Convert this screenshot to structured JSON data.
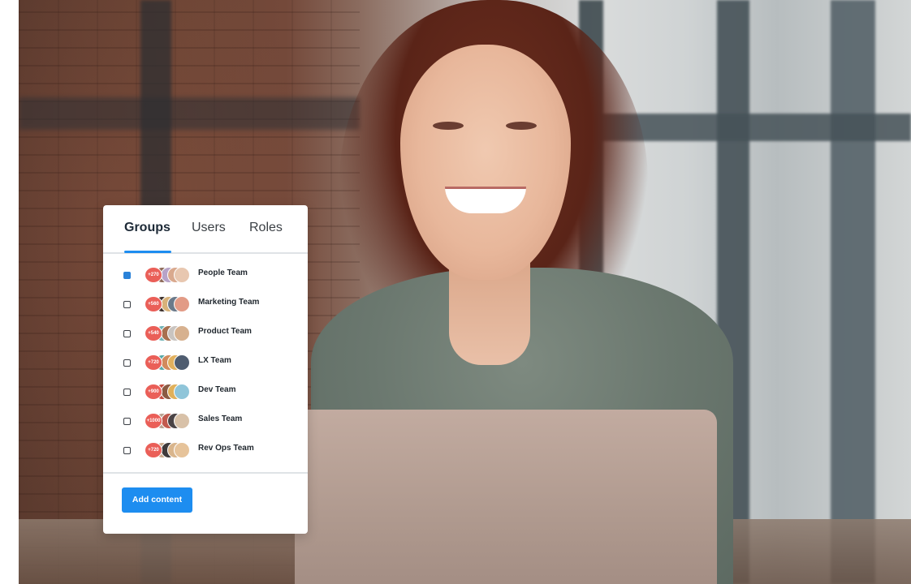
{
  "panel": {
    "tabs": [
      {
        "label": "Groups",
        "active": true
      },
      {
        "label": "Users",
        "active": false
      },
      {
        "label": "Roles",
        "active": false
      }
    ],
    "groups": [
      {
        "name": "People Team",
        "count": "+270",
        "checked": true
      },
      {
        "name": "Marketing Team",
        "count": "+560",
        "checked": false
      },
      {
        "name": "Product Team",
        "count": "+540",
        "checked": false
      },
      {
        "name": "LX Team",
        "count": "+720",
        "checked": false
      },
      {
        "name": "Dev Team",
        "count": "+900",
        "checked": false
      },
      {
        "name": "Sales Team",
        "count": "+1000",
        "checked": false
      },
      {
        "name": "Rev Ops Team",
        "count": "+720",
        "checked": false
      }
    ],
    "add_button_label": "Add content"
  },
  "colors": {
    "accent": "#1d8df0",
    "count_badge": "#ea5f58",
    "checkbox_checked": "#2a82d8"
  }
}
